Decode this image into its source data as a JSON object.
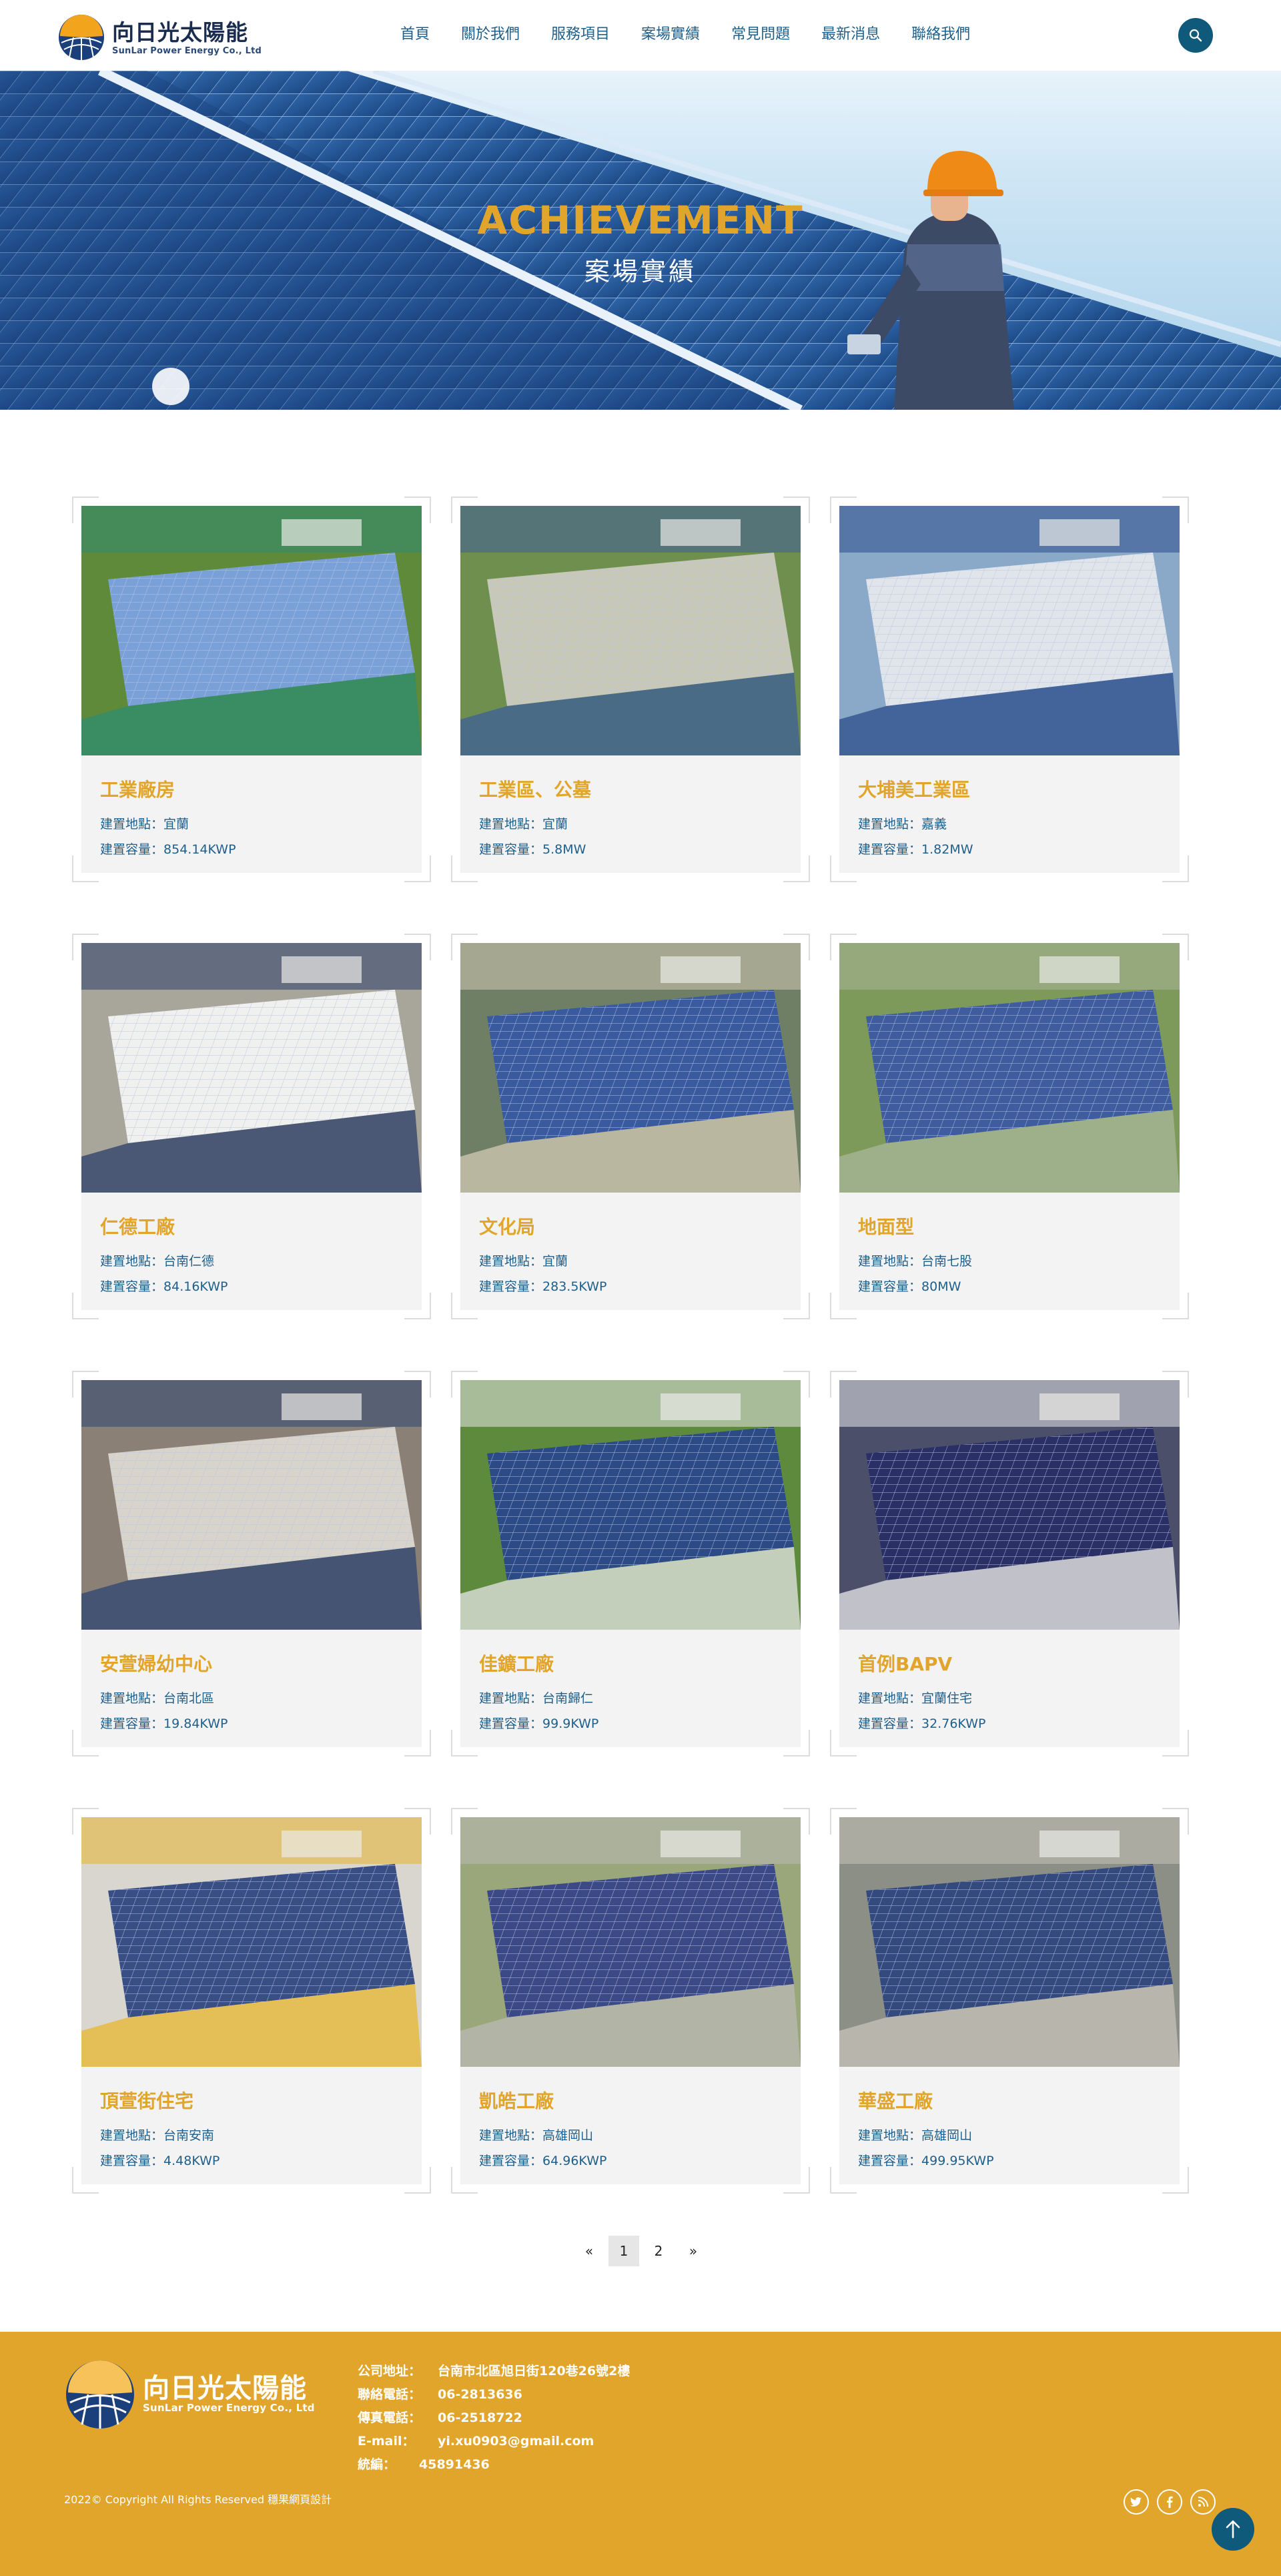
{
  "header": {
    "logo_cn": "向日光太陽能",
    "logo_en": "SunLar Power Energy Co., Ltd",
    "nav": [
      "首頁",
      "關於我們",
      "服務項目",
      "案場實績",
      "常見問題",
      "最新消息",
      "聯絡我們"
    ]
  },
  "hero": {
    "title": "ACHIEVEMENT",
    "subtitle": "案場實績"
  },
  "projects": [
    {
      "title": "工業廠房",
      "location_label": "建置地點：",
      "location": "宜蘭",
      "capacity_label": "建置容量：",
      "capacity": "854.14KWP"
    },
    {
      "title": "工業區、公墓",
      "location_label": "建置地點：",
      "location": "宜蘭",
      "capacity_label": "建置容量：",
      "capacity": "5.8MW"
    },
    {
      "title": "大埔美工業區",
      "location_label": "建置地點：",
      "location": "嘉義",
      "capacity_label": "建置容量：",
      "capacity": "1.82MW"
    },
    {
      "title": "仁德工廠",
      "location_label": "建置地點：",
      "location": "台南仁德",
      "capacity_label": "建置容量：",
      "capacity": "84.16KWP"
    },
    {
      "title": "文化局",
      "location_label": "建置地點：",
      "location": "宜蘭",
      "capacity_label": "建置容量：",
      "capacity": "283.5KWP"
    },
    {
      "title": "地面型",
      "location_label": "建置地點：",
      "location": "台南七股",
      "capacity_label": "建置容量：",
      "capacity": "80MW"
    },
    {
      "title": "安萱婦幼中心",
      "location_label": "建置地點：",
      "location": "台南北區",
      "capacity_label": "建置容量：",
      "capacity": "19.84KWP"
    },
    {
      "title": "佳鑛工廠",
      "location_label": "建置地點：",
      "location": "台南歸仁",
      "capacity_label": "建置容量：",
      "capacity": "99.9KWP"
    },
    {
      "title": "首例BAPV",
      "location_label": "建置地點：",
      "location": "宜蘭住宅",
      "capacity_label": "建置容量：",
      "capacity": "32.76KWP"
    },
    {
      "title": "頂萱街住宅",
      "location_label": "建置地點：",
      "location": "台南安南",
      "capacity_label": "建置容量：",
      "capacity": "4.48KWP"
    },
    {
      "title": "凱皓工廠",
      "location_label": "建置地點：",
      "location": "高雄岡山",
      "capacity_label": "建置容量：",
      "capacity": "64.96KWP"
    },
    {
      "title": "華盛工廠",
      "location_label": "建置地點：",
      "location": "高雄岡山",
      "capacity_label": "建置容量：",
      "capacity": "499.95KWP"
    }
  ],
  "pagination": {
    "prev": "«",
    "pages": [
      "1",
      "2"
    ],
    "current": "1",
    "next": "»"
  },
  "footer": {
    "logo_cn": "向日光太陽能",
    "logo_en": "SunLar Power Energy Co., Ltd",
    "info": [
      {
        "key": "公司地址：",
        "value": "台南市北區旭日街120巷26號2樓"
      },
      {
        "key": "聯絡電話：",
        "value": "06-2813636"
      },
      {
        "key": "傳真電話：",
        "value": "06-2518722"
      },
      {
        "key": "E-mail：",
        "value": "yi.xu0903@gmail.com"
      },
      {
        "key": "統編：",
        "value": "45891436"
      }
    ],
    "copyright": "2022© Copyright All Rights Reserved   穩果網頁設計",
    "social": [
      "twitter-icon",
      "facebook-icon",
      "rss-icon"
    ]
  },
  "colors": {
    "accent_gold": "#e2a52b",
    "nav_blue": "#1f5f8b",
    "dark_teal": "#0f5a7a"
  }
}
